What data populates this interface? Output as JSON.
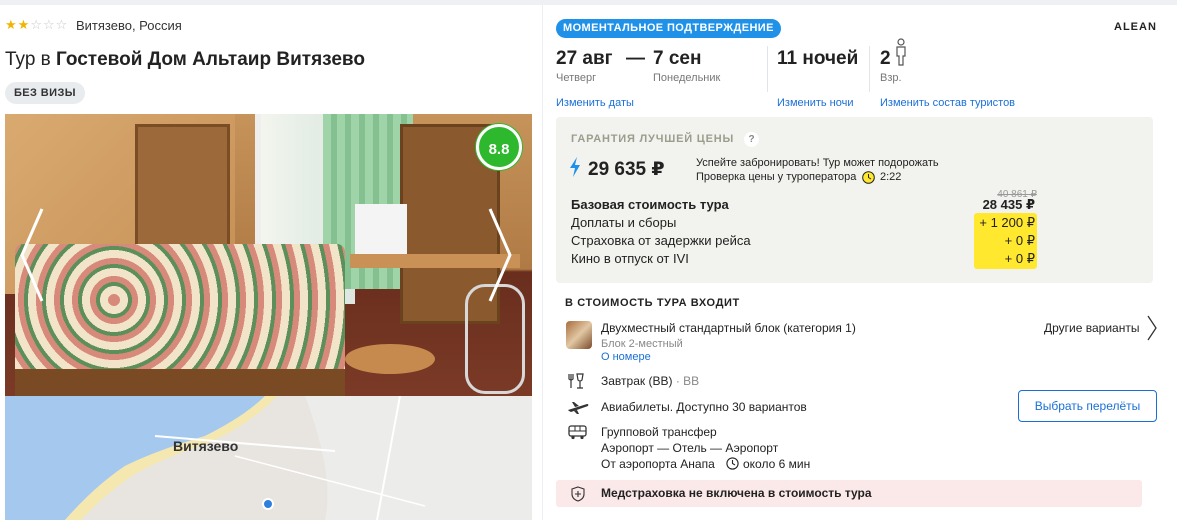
{
  "hotel": {
    "stars_filled": 2,
    "stars_total": 5,
    "location": "Витязево, Россия",
    "title_prefix": "Тур в",
    "title_name": "Гостевой Дом Альтаир Витязево",
    "visa_badge": "БЕЗ ВИЗЫ",
    "rating": "8.8",
    "map_label": "Витязево"
  },
  "tour": {
    "instant_badge": "МОМЕНТАЛЬНОЕ ПОДТВЕРЖДЕНИЕ",
    "operator": "ALEAN",
    "date_from": "27 авг",
    "date_dash": "—",
    "date_to": "7 сен",
    "day_from": "Четверг",
    "day_to": "Понедельник",
    "nights": "11 ночей",
    "adults": "2",
    "adults_label": "Взр.",
    "link_dates": "Изменить даты",
    "link_nights": "Изменить ночи",
    "link_tourists": "Изменить состав туристов"
  },
  "pricing": {
    "guarantee": "ГАРАНТИЯ ЛУЧШЕЙ ЦЕНЫ",
    "qmark": "?",
    "price": "29 635 ₽",
    "hurry_line1": "Успейте забронировать! Тур может подорожать",
    "hurry_line2": "Проверка цены у туроператора",
    "timer": "2:22",
    "old_price": "40 861 ₽",
    "rows": [
      {
        "label": "Базовая стоимость тура",
        "value": "28 435 ₽"
      },
      {
        "label": "Доплаты и сборы",
        "value": "+ 1 200 ₽"
      },
      {
        "label": "Страховка от задержки рейса",
        "value": "+ 0 ₽"
      },
      {
        "label": "Кино в отпуск от IVI",
        "value": "+ 0 ₽"
      }
    ]
  },
  "included": {
    "title": "В СТОИМОСТЬ ТУРА ВХОДИТ",
    "room_name": "Двухместный стандартный блок (категория 1)",
    "room_sub": "Блок 2-местный",
    "room_link": "О номере",
    "other_variants": "Другие варианты",
    "meal": "Завтрак (BB)",
    "meal_code": "· BB",
    "flights": "Авиабилеты. Доступно 30 вариантов",
    "flights_button": "Выбрать перелёты",
    "transfer_title": "Групповой трансфер",
    "transfer_route": "Аэропорт — Отель — Аэропорт",
    "transfer_from": "От аэропорта Анапа",
    "transfer_time": "около 6 мин",
    "insurance": "Медстраховка не включена в стоимость тура"
  },
  "colors": {
    "accent": "#1a6fd6",
    "badge_blue": "#1f91e8",
    "rating_green": "#2eb82e",
    "highlight_yellow": "#ffe82e",
    "insurance_bg": "#fbe9ea"
  }
}
